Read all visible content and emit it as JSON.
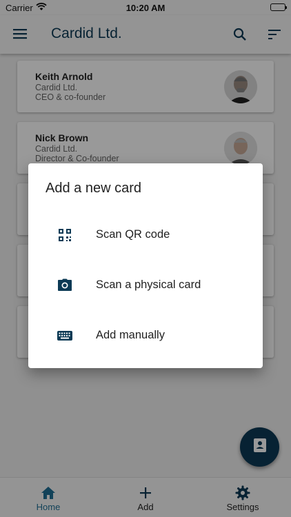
{
  "status_bar": {
    "carrier": "Carrier",
    "time": "10:20 AM"
  },
  "app_bar": {
    "title": "Cardid Ltd.",
    "icons": [
      "menu-icon",
      "search-icon",
      "sort-icon"
    ]
  },
  "cards": [
    {
      "name": "Keith Arnold",
      "company": "Cardid Ltd.",
      "role": "CEO & co-founder"
    },
    {
      "name": "Nick Brown",
      "company": "Cardid Ltd.",
      "role": "Director & Co-founder"
    },
    {
      "name": "",
      "company": "",
      "role": ""
    },
    {
      "name": "",
      "company": "",
      "role": ""
    },
    {
      "name": "",
      "company": "",
      "role": ""
    }
  ],
  "dialog": {
    "title": "Add a new card",
    "options": [
      {
        "label": "Scan QR code",
        "icon": "qr-code-icon"
      },
      {
        "label": "Scan a physical card",
        "icon": "camera-icon"
      },
      {
        "label": "Add manually",
        "icon": "keyboard-icon"
      }
    ]
  },
  "fab": {
    "icon": "contact-card-icon"
  },
  "tabs": [
    {
      "label": "Home",
      "icon": "home-icon",
      "active": true
    },
    {
      "label": "Add",
      "icon": "plus-icon",
      "active": false
    },
    {
      "label": "Settings",
      "icon": "gear-icon",
      "active": false
    }
  ],
  "colors": {
    "primary": "#0c3a55",
    "active_tab": "#1f6f95",
    "scrim": "rgba(0,0,0,0.4)"
  }
}
